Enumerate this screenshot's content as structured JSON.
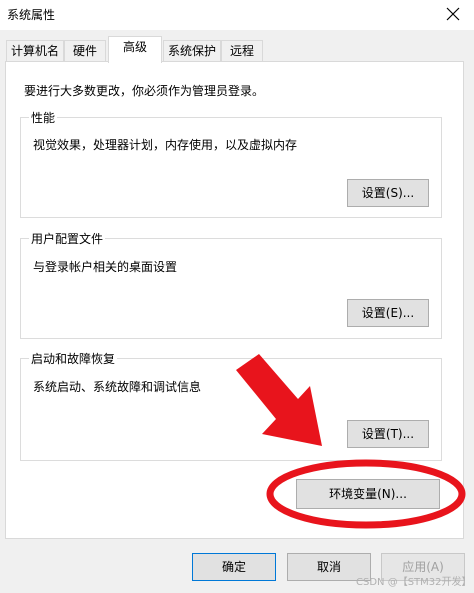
{
  "window": {
    "title": "系统属性"
  },
  "tabs": [
    {
      "label": "计算机名"
    },
    {
      "label": "硬件"
    },
    {
      "label": "高级"
    },
    {
      "label": "系统保护"
    },
    {
      "label": "远程"
    }
  ],
  "active_tab": "高级",
  "notice": "要进行大多数更改，你必须作为管理员登录。",
  "groups": {
    "performance": {
      "title": "性能",
      "description": "视觉效果，处理器计划，内存使用，以及虚拟内存",
      "button": "设置(S)..."
    },
    "user_profiles": {
      "title": "用户配置文件",
      "description": "与登录帐户相关的桌面设置",
      "button": "设置(E)..."
    },
    "startup_recovery": {
      "title": "启动和故障恢复",
      "description": "系统启动、系统故障和调试信息",
      "button": "设置(T)..."
    }
  },
  "env_button": "环境变量(N)...",
  "footer": {
    "ok": "确定",
    "cancel": "取消",
    "apply": "应用(A)"
  },
  "watermark": "CSDN @【STM32开发】",
  "colors": {
    "annotation_red": "#e8141c",
    "focus_blue": "#0078d7"
  },
  "icons": {
    "close": "close-icon",
    "annotation_arrow": "red-arrow",
    "annotation_ellipse": "red-ellipse"
  }
}
